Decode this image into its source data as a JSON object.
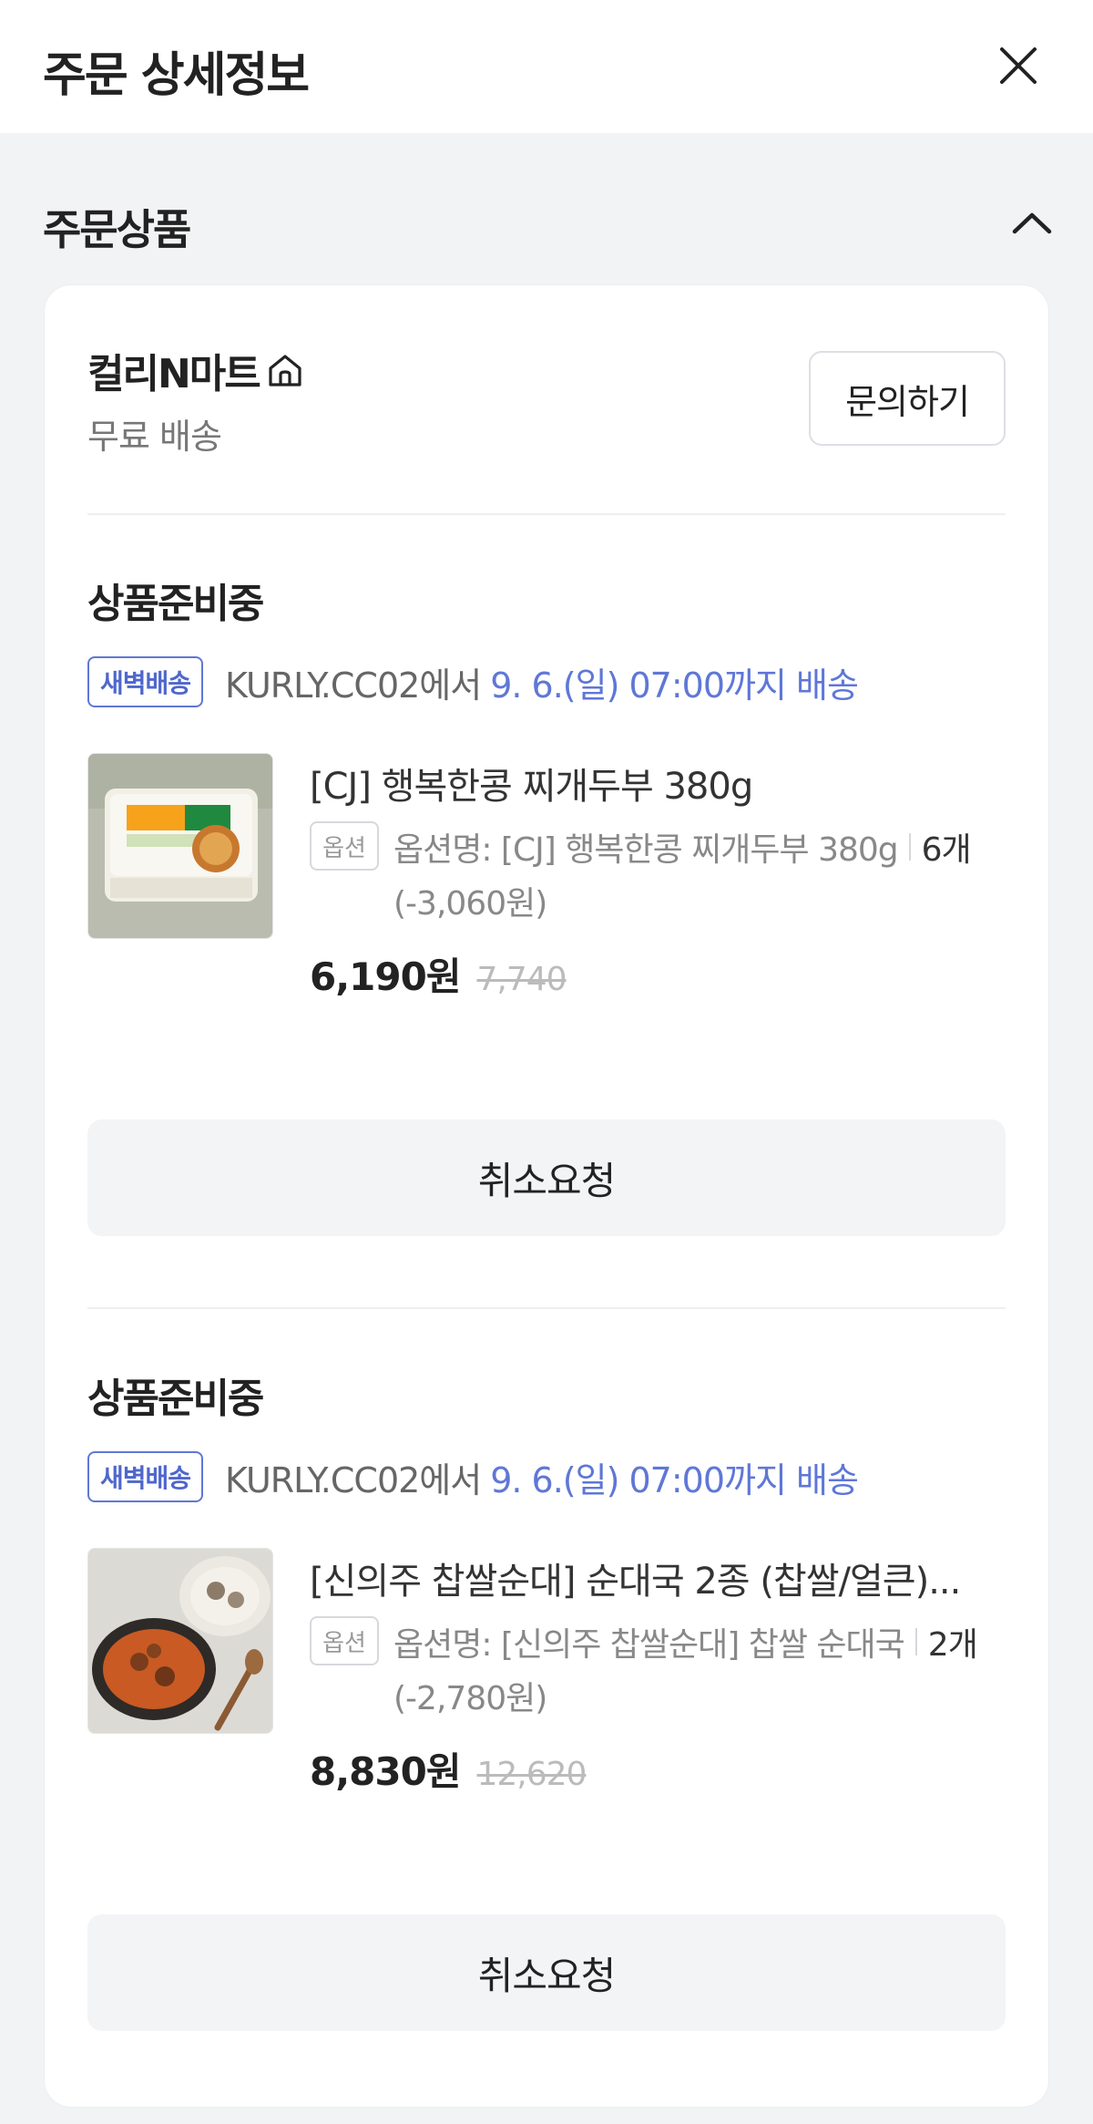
{
  "header": {
    "title": "주문 상세정보"
  },
  "section": {
    "title": "주문상품"
  },
  "seller": {
    "name": "컬리N마트",
    "shipping": "무료 배송",
    "inquiry_label": "문의하기"
  },
  "items": [
    {
      "status": "상품준비중",
      "badge": "새벽배송",
      "delivery_from": "KURLY.CC02에서",
      "delivery_date": "9. 6.(일) 07:00까지 배송",
      "name": "[CJ] 행복한콩 찌개두부 380g",
      "option_badge": "옵션",
      "option_name": "옵션명: [CJ] 행복한콩 찌개두부 380g",
      "quantity": "6개",
      "discount": "(-3,060원)",
      "price": "6,190원",
      "original_price": "7,740",
      "cancel_label": "취소요청"
    },
    {
      "status": "상품준비중",
      "badge": "새벽배송",
      "delivery_from": "KURLY.CC02에서",
      "delivery_date": "9. 6.(일) 07:00까지 배송",
      "name": "[신의주 찹쌀순대] 순대국 2종 (찹쌀/얼큰)...",
      "option_badge": "옵션",
      "option_name": "옵션명: [신의주 찹쌀순대] 찹쌀 순대국",
      "quantity": "2개",
      "discount": "(-2,780원)",
      "price": "8,830원",
      "original_price": "12,620",
      "cancel_label": "취소요청"
    }
  ],
  "icons": {
    "close": "close-icon",
    "collapse": "chevron-up-icon",
    "home": "home-icon"
  },
  "colors": {
    "accent": "#5f77d6",
    "background": "#f2f3f5"
  }
}
